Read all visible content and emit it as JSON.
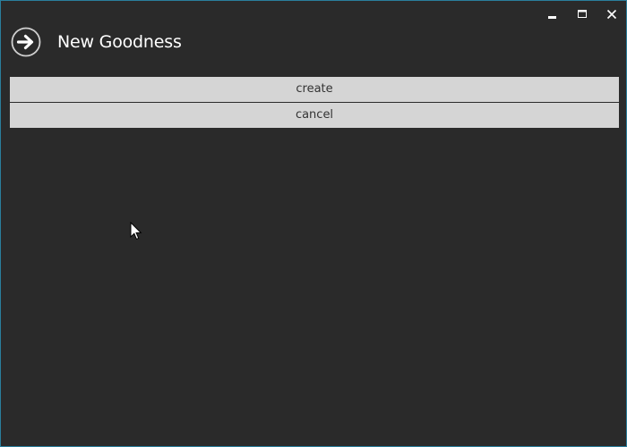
{
  "window": {
    "title": "New Goodness",
    "controls": {
      "minimize_icon": "minimize-icon",
      "maximize_icon": "maximize-icon",
      "close_icon": "close-icon"
    },
    "back_icon": "arrow-right-circle-icon"
  },
  "actions": {
    "create_label": "create",
    "cancel_label": "cancel"
  },
  "colors": {
    "background": "#2a2a2a",
    "button_background": "#d5d5d5",
    "button_text": "#333333",
    "title_text": "#ffffff",
    "window_border": "#2a7f9c"
  }
}
